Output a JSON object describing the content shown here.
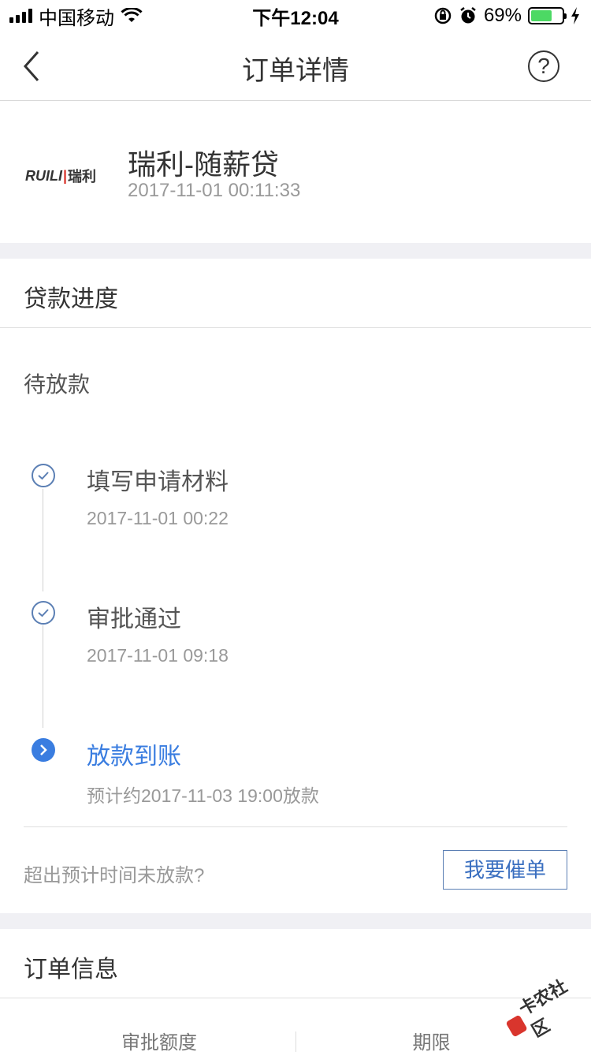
{
  "status_bar": {
    "carrier": "中国移动",
    "time": "下午12:04",
    "battery_percent": "69%",
    "battery_level": 0.69
  },
  "nav": {
    "title": "订单详情",
    "help_glyph": "?"
  },
  "product": {
    "logo_text_left": "RUILI",
    "logo_text_right": "瑞利",
    "name": "瑞利-随薪贷",
    "created_time": "2017-11-01 00:11:33"
  },
  "loan_progress": {
    "section_title": "贷款进度",
    "status": "待放款",
    "steps": [
      {
        "title": "填写申请材料",
        "time": "2017-11-01 00:22",
        "state": "done"
      },
      {
        "title": "审批通过",
        "time": "2017-11-01 09:18",
        "state": "done"
      },
      {
        "title": "放款到账",
        "time": "预计约2017-11-03 19:00放款",
        "state": "active"
      }
    ],
    "overdue_prompt": "超出预计时间未放款?",
    "urge_button": "我要催单"
  },
  "order_info": {
    "section_title": "订单信息",
    "columns": [
      "审批额度",
      "期限"
    ]
  },
  "watermark": {
    "text": "卡农社区"
  },
  "colors": {
    "accent": "#3a7de0",
    "done_icon": "#5b7fb4",
    "gap_bg": "#f0f0f4",
    "battery_green": "#4cd964"
  }
}
